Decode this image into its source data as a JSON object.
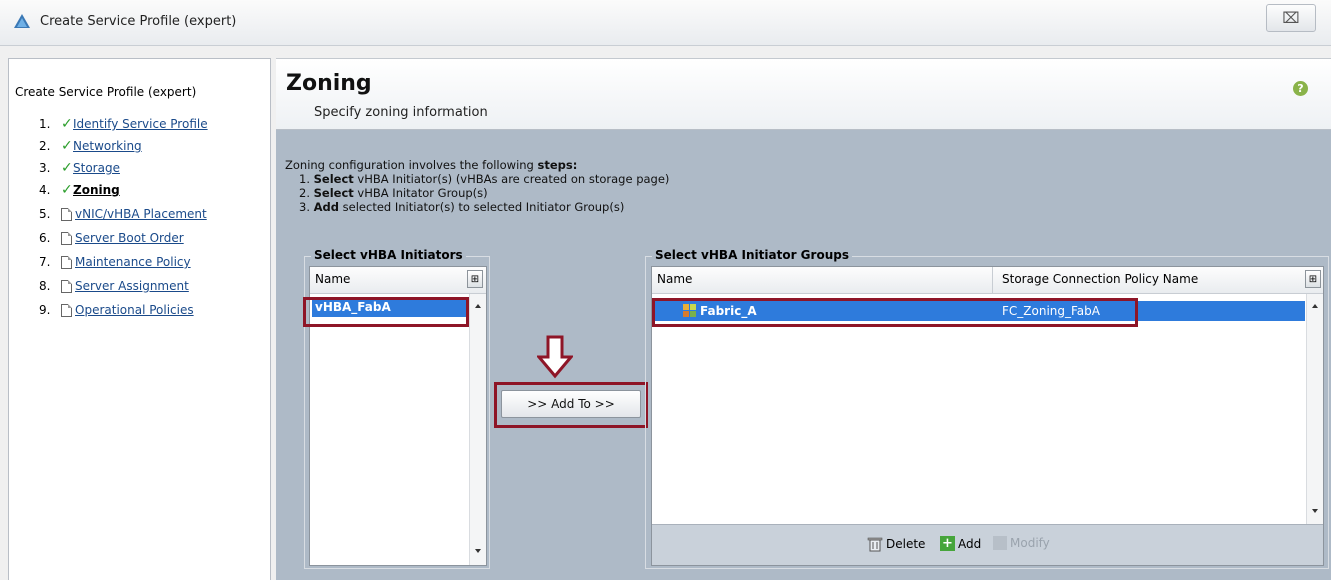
{
  "window": {
    "title": "Create Service Profile (expert)",
    "close_symbol": "⌧"
  },
  "wizard": {
    "heading": "Create Service Profile (expert)",
    "steps": [
      {
        "num": "1.",
        "label": "Identify Service Profile",
        "done": true
      },
      {
        "num": "2.",
        "label": "Networking",
        "done": true
      },
      {
        "num": "3.",
        "label": "Storage",
        "done": true
      },
      {
        "num": "4.",
        "label": "Zoning",
        "done": true,
        "current": true
      },
      {
        "num": "5.",
        "label": "vNIC/vHBA Placement",
        "done": false
      },
      {
        "num": "6.",
        "label": "Server Boot Order",
        "done": false
      },
      {
        "num": "7.",
        "label": "Maintenance Policy",
        "done": false
      },
      {
        "num": "8.",
        "label": "Server Assignment",
        "done": false
      },
      {
        "num": "9.",
        "label": "Operational Policies",
        "done": false
      }
    ]
  },
  "page": {
    "title": "Zoning",
    "subtitle": "Specify zoning information",
    "help": "?"
  },
  "intro": {
    "line1_text": "Zoning configuration involves the following ",
    "line1_bold": "steps:",
    "steps": [
      {
        "num": "1. ",
        "bold": "Select",
        "rest": " vHBA Initiator(s) (vHBAs are created on storage page)"
      },
      {
        "num": "2. ",
        "bold": "Select",
        "rest": " vHBA Initator Group(s)"
      },
      {
        "num": "3. ",
        "bold": "Add",
        "rest": " selected Initiator(s) to selected Initiator Group(s)"
      }
    ]
  },
  "initiators": {
    "group_title": "Select vHBA Initiators",
    "column": "Name",
    "rows": [
      "vHBA_FabA"
    ]
  },
  "add_to_button": ">> Add To >>",
  "groups": {
    "group_title": "Select vHBA Initiator Groups",
    "columns": [
      "Name",
      "Storage Connection Policy Name"
    ],
    "rows": [
      {
        "name": "Fabric_A",
        "policy": "FC_Zoning_FabA"
      }
    ],
    "toolbar": {
      "delete": "Delete",
      "add": "Add",
      "modify": "Modify"
    }
  },
  "colors": {
    "highlight": "#8e1527",
    "selection": "#2e7bdc",
    "panel_bg": "#aebac7"
  }
}
